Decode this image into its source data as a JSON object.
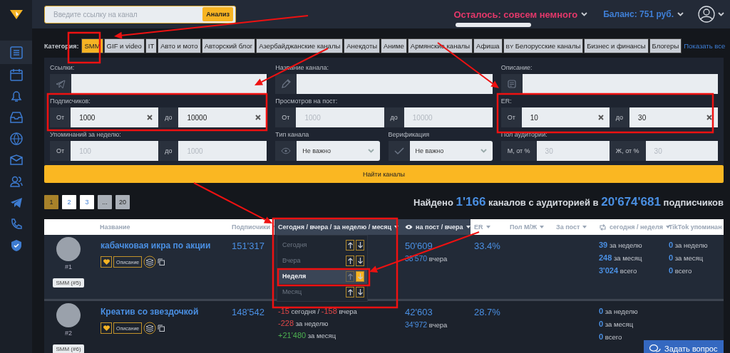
{
  "topbar": {
    "search": {
      "placeholder": "Введите ссылку на канал",
      "button": "Анализ"
    },
    "remaining": {
      "text": "Осталось: совсем немного",
      "level": 1
    },
    "balance": "Баланс: 751 руб."
  },
  "categories": {
    "label": "Категория:",
    "items": [
      {
        "label": "SMM",
        "selected": true
      },
      {
        "label": "GIF и video",
        "selected": false
      },
      {
        "label": "IT",
        "selected": false
      },
      {
        "label": "Авто и мото",
        "selected": false
      },
      {
        "label": "Авторский блог",
        "selected": false
      },
      {
        "label": "Азербайджанские каналы",
        "selected": false
      },
      {
        "label": "Анекдоты",
        "selected": false
      },
      {
        "label": "Аниме",
        "selected": false
      },
      {
        "label": "Армянские каналы",
        "selected": false
      },
      {
        "label": "Афиша",
        "selected": false
      },
      {
        "prefix": "BY",
        "label": "Белорусские каналы",
        "selected": false
      },
      {
        "label": "Бизнес и финансы",
        "selected": false
      },
      {
        "label": "Блогеры",
        "selected": false
      }
    ],
    "show_all": "Показать все"
  },
  "filters": [
    {
      "kind": "text",
      "label": "Ссылки:"
    },
    {
      "kind": "text",
      "label": "Название канала:"
    },
    {
      "kind": "text",
      "label": "Описание:"
    },
    {
      "kind": "range",
      "label": "Подписчиков:",
      "from": {
        "prefix": "От",
        "value": "1000"
      },
      "to": {
        "prefix": "до",
        "value": "10000"
      }
    },
    {
      "kind": "range",
      "label": "Просмотров на пост:",
      "from": {
        "prefix": "От",
        "placeholder": "1000"
      },
      "to": {
        "prefix": "до",
        "placeholder": "10000"
      }
    },
    {
      "kind": "range",
      "label": "ER:",
      "from": {
        "prefix": "От",
        "value": "10"
      },
      "to": {
        "prefix": "до",
        "value": "30"
      }
    },
    {
      "kind": "range",
      "label": "Упоминаний за неделю:",
      "from": {
        "prefix": "От",
        "placeholder": "100"
      },
      "to": {
        "prefix": "до",
        "placeholder": "1000"
      }
    },
    {
      "kind": "select",
      "label": "Тип канала",
      "value": "Не важно"
    },
    {
      "kind": "select",
      "label": "Верификация",
      "value": "Не важно"
    },
    {
      "kind": "range",
      "label": "Пол аудитории:",
      "from": {
        "prefix": "М, от %",
        "placeholder": "30"
      },
      "to": {
        "prefix": "Ж, от %",
        "placeholder": "30"
      }
    }
  ],
  "search_button": "Найти каналы",
  "pagination": [
    {
      "label": "1",
      "kind": "page",
      "selected": true
    },
    {
      "label": "2",
      "kind": "page",
      "selected": false
    },
    {
      "label": "3",
      "kind": "page",
      "selected": false
    },
    {
      "label": "...",
      "kind": "muted",
      "selected": false
    },
    {
      "label": "20",
      "kind": "muted",
      "selected": false
    }
  ],
  "found": [
    {
      "text": "Найдено",
      "kind": "plain"
    },
    {
      "text": "1'166",
      "kind": "number"
    },
    {
      "text": "каналов с аудиторией в",
      "kind": "plain"
    },
    {
      "text": "20'674'681",
      "kind": "number"
    },
    {
      "text": "подписчиков",
      "kind": "plain"
    }
  ],
  "table": {
    "columns": [
      {
        "label": "Название",
        "sortable": false,
        "sorted": false
      },
      {
        "label": "Подписчики",
        "sortable": true,
        "sorted": false
      },
      {
        "label": "Сегодня / вчера / за неделю / месяц",
        "sortable": true,
        "sorted": true
      },
      {
        "label": "на пост / вчера",
        "sortable": true,
        "sorted": true
      },
      {
        "label": "ER",
        "sortable": true,
        "sorted": false
      },
      {
        "label": "Пол М/Ж",
        "sortable": true,
        "sorted": false
      },
      {
        "label": "За пост",
        "sortable": true,
        "sorted": false
      },
      {
        "label": "сегодня / неделя",
        "sortable": true,
        "sorted": false
      },
      {
        "label": "TikTok упоминан",
        "sortable": false,
        "sorted": false
      }
    ],
    "rows": [
      {
        "rank": "#1",
        "name": "кабачковая икра по акции",
        "description_button": "Описание",
        "tag": "SMM (#5)",
        "subscribers": "151'317",
        "growth": [],
        "views": {
          "value": "50'609",
          "sub_value": "38'570",
          "sub_label": "вчера"
        },
        "er": "33.4%",
        "reposts": [
          "**39** за неделю",
          "**248** за месяц",
          "**3'024** всего"
        ],
        "tiktok": [
          "**0** за неделю",
          "**0** за месяц",
          "**0** всего"
        ]
      },
      {
        "rank": "#2",
        "name": "Креатив со звездочкой",
        "description_button": "Описание",
        "tag": "SMM (#6)",
        "subscribers": "148'542",
        "growth": [
          {
            "text": "**-15** сегодня / **-158** вчера",
            "color": "#e04848"
          },
          {
            "text": "**-228** за неделю",
            "color": "#e04848"
          },
          {
            "text": "**+21'480** за месяц",
            "color": "#4caf50"
          }
        ],
        "views": {
          "value": "42'603",
          "sub_value": "34'972",
          "sub_label": "вчера"
        },
        "er": "28.7%",
        "reposts": [
          "**0** за неделю",
          "**0** за месяц",
          "**0** всего"
        ],
        "tiktok": []
      }
    ],
    "sort_menu": [
      {
        "label": "Сегодня",
        "selected": false,
        "desc_active": false
      },
      {
        "label": "Вчера",
        "selected": false,
        "desc_active": false
      },
      {
        "label": "Неделя",
        "selected": true,
        "desc_active": true
      },
      {
        "label": "Месяц",
        "selected": false,
        "desc_active": false
      }
    ]
  },
  "chat_button": "Задать вопрос"
}
